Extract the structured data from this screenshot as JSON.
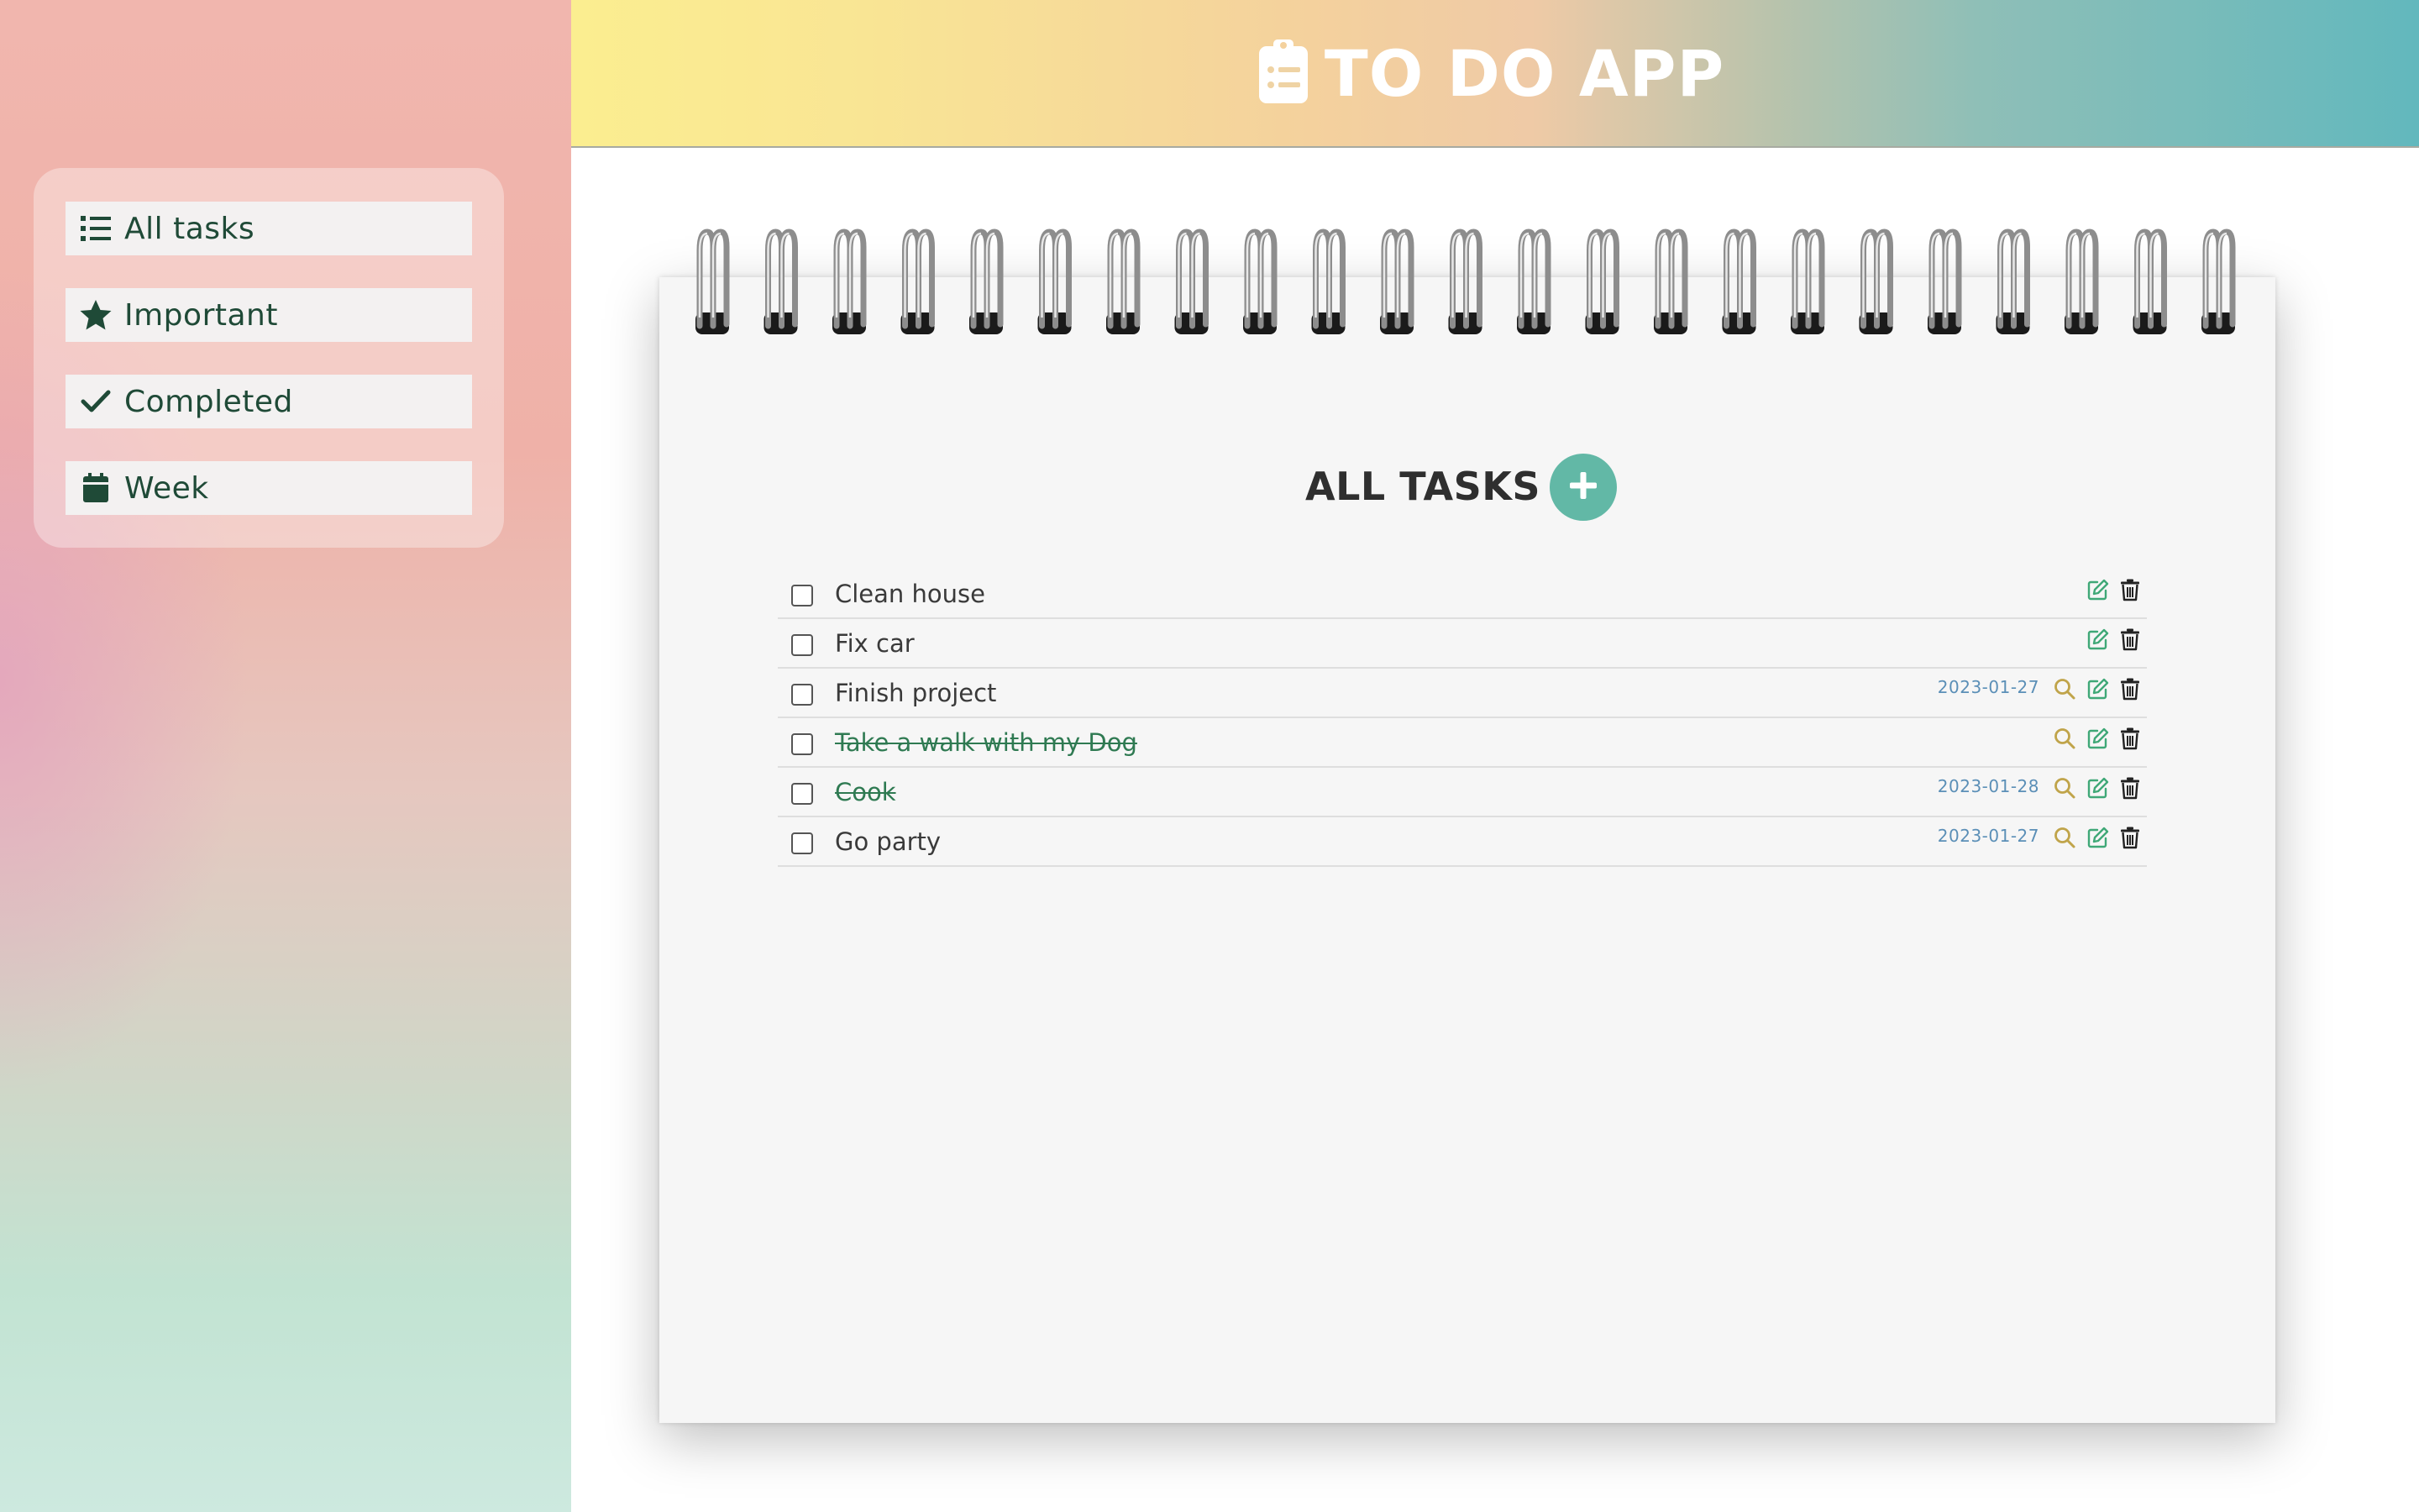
{
  "app": {
    "title": "TO DO APP",
    "header_icon": "clipboard-list-icon"
  },
  "sidebar": {
    "items": [
      {
        "label": "All tasks",
        "icon": "list-icon"
      },
      {
        "label": "Important",
        "icon": "star-icon"
      },
      {
        "label": "Completed",
        "icon": "check-icon"
      },
      {
        "label": "Week",
        "icon": "calendar-icon"
      }
    ]
  },
  "main": {
    "heading": "ALL TASKS",
    "add_icon": "plus-icon",
    "tasks": [
      {
        "title": "Clean house",
        "completed": false,
        "date": "",
        "has_view": false
      },
      {
        "title": "Fix car",
        "completed": false,
        "date": "",
        "has_view": false
      },
      {
        "title": "Finish project",
        "completed": false,
        "date": "2023-01-27",
        "has_view": true
      },
      {
        "title": "Take a walk with my Dog",
        "completed": true,
        "date": "",
        "has_view": true
      },
      {
        "title": "Cook",
        "completed": true,
        "date": "2023-01-28",
        "has_view": true
      },
      {
        "title": "Go party",
        "completed": false,
        "date": "2023-01-27",
        "has_view": true
      }
    ]
  },
  "colors": {
    "accent": "#62b8a6",
    "sidebar_text": "#1f4a37",
    "completed_text": "#2f7a52",
    "date_text": "#5b8fb7",
    "edit_icon": "#3fa877",
    "view_icon": "#c0a44a"
  }
}
